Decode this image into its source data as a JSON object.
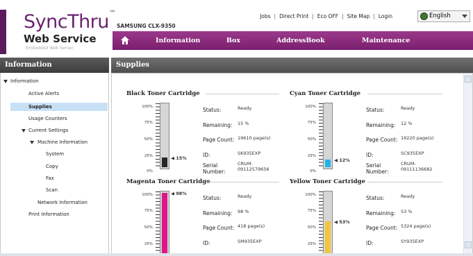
{
  "logo": {
    "name": "SyncThru",
    "tm": "™",
    "subtitle": "Web Service",
    "tagline": "Embedded Web Server"
  },
  "model": "SAMSUNG CLX-9350",
  "top_links": [
    "Jobs",
    "Direct Print",
    "Eco OFF",
    "Site Map",
    "Login"
  ],
  "language": {
    "selected": "English"
  },
  "nav": {
    "items": [
      "Information",
      "Box",
      "AddressBook",
      "Maintenance"
    ]
  },
  "left_panel": {
    "title": "Information",
    "tree": [
      "Information",
      "Active Alerts",
      "Supplies",
      "Usage Counters",
      "Current Settings",
      "Machine Information",
      "System",
      "Copy",
      "Fax",
      "Scan",
      "Network Information",
      "Print Information"
    ],
    "selected": "Supplies"
  },
  "main": {
    "title": "Supplies",
    "labels": {
      "status": "Status:",
      "remaining": "Remaining:",
      "page_count": "Page Count:",
      "id": "ID:",
      "serial": "Serial Number:"
    },
    "scale": [
      "100%",
      "75%",
      "50%",
      "25%",
      "0%"
    ],
    "cartridges": [
      {
        "name": "Black Toner Cartridge",
        "level": "15%",
        "level_value": 0.15,
        "color": "#262626",
        "status": "Ready",
        "remaining": "15 %",
        "page_count": "19610 page(s)",
        "id": "SK935EXP",
        "serial_line1": "CRUM-",
        "serial_line2": "09112579656"
      },
      {
        "name": "Cyan Toner Cartridge",
        "level": "12%",
        "level_value": 0.12,
        "color": "#1fb3e8",
        "status": "Ready",
        "remaining": "12 %",
        "page_count": "19220 page(s)",
        "id": "SC935EXP",
        "serial_line1": "CRUM-",
        "serial_line2": "09111136682"
      },
      {
        "name": "Magenta Toner Cartridge",
        "level": "98%",
        "level_value": 0.98,
        "color": "#e0158a",
        "status": "Ready",
        "remaining": "98 %",
        "page_count": "418 page(s)",
        "id": "SM935EXP"
      },
      {
        "name": "Yellow Toner Cartridge",
        "level": "53%",
        "level_value": 0.53,
        "color": "#f2c63a",
        "status": "Ready",
        "remaining": "53 %",
        "page_count": "5324 page(s)",
        "id": "SY935EXP"
      }
    ]
  }
}
